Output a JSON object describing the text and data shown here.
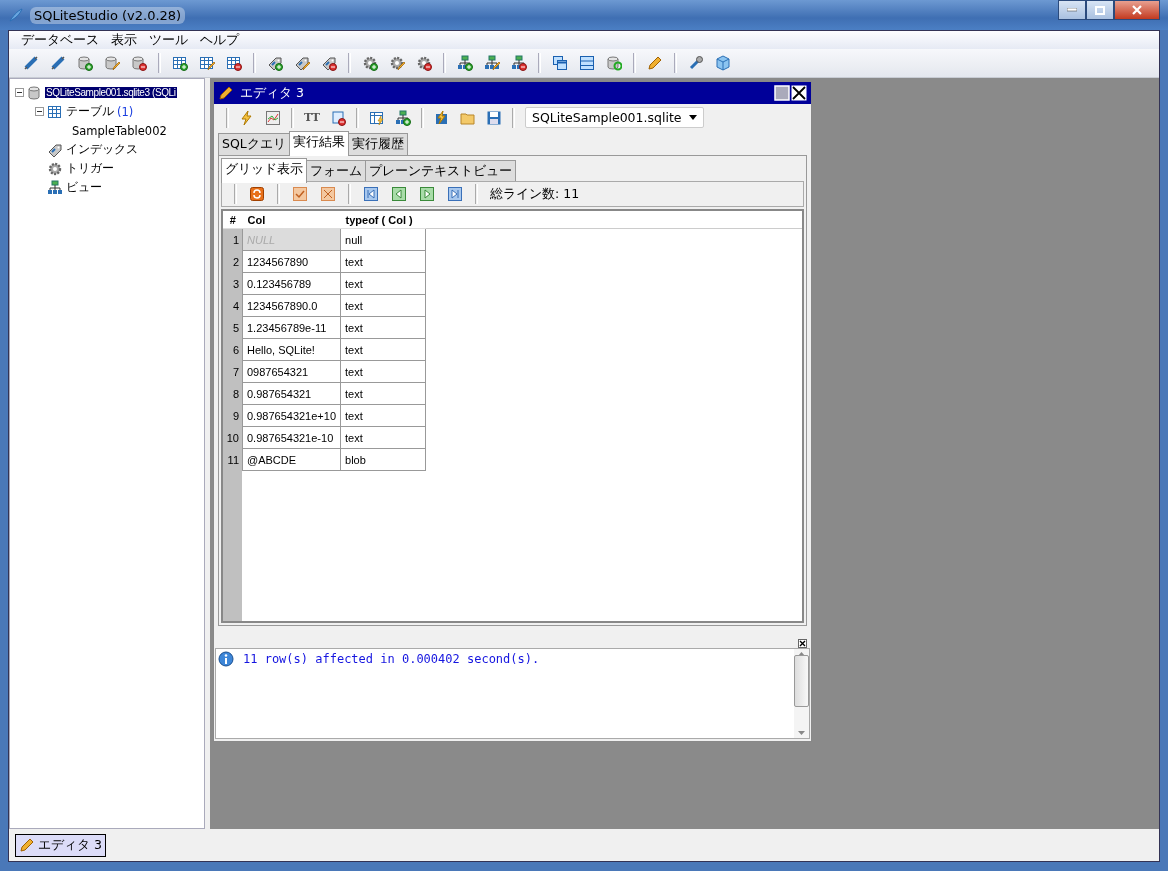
{
  "window": {
    "title": "SQLiteStudio (v2.0.28)"
  },
  "menu": [
    "データベース",
    "表示",
    "ツール",
    "ヘルプ"
  ],
  "tree": {
    "label": "SQLiteSample001.sqlite3 (SQLi",
    "kind": "database",
    "selected": true,
    "expanded": true,
    "children": [
      {
        "label": "テーブル",
        "count": "(1)",
        "kind": "table",
        "expanded": true,
        "children": [
          {
            "label": "SampleTable002"
          }
        ]
      },
      {
        "label": "インデックス",
        "kind": "index"
      },
      {
        "label": "トリガー",
        "kind": "trigger"
      },
      {
        "label": "ビュー",
        "kind": "view"
      }
    ]
  },
  "editor": {
    "title": "エディタ 3",
    "toolbar_text": "TT",
    "database": "SQLiteSample001.sqlite",
    "tabs": [
      {
        "label": "SQLクエリ",
        "selected": false
      },
      {
        "label": "実行結果",
        "selected": true
      },
      {
        "label": "実行履歴",
        "selected": false
      }
    ],
    "view_tabs": [
      {
        "label": "グリッド表示",
        "selected": true
      },
      {
        "label": "フォーム",
        "selected": false
      },
      {
        "label": "プレーンテキストビュー",
        "selected": false
      }
    ],
    "total": "総ライン数: 11",
    "columns": [
      "#",
      "Col",
      "typeof ( Col )"
    ],
    "rows": [
      {
        "num": "1",
        "col": "NULL",
        "type": "null",
        "is_null": true
      },
      {
        "num": "2",
        "col": "1234567890",
        "type": "text",
        "is_null": false
      },
      {
        "num": "3",
        "col": "0.123456789",
        "type": "text",
        "is_null": false
      },
      {
        "num": "4",
        "col": "1234567890.0",
        "type": "text",
        "is_null": false
      },
      {
        "num": "5",
        "col": "1.23456789e-11",
        "type": "text",
        "is_null": false
      },
      {
        "num": "6",
        "col": "Hello, SQLite!",
        "type": "text",
        "is_null": false
      },
      {
        "num": "7",
        "col": "0987654321",
        "type": "text",
        "is_null": false
      },
      {
        "num": "8",
        "col": "0.987654321",
        "type": "text",
        "is_null": false
      },
      {
        "num": "9",
        "col": "0.987654321e+10",
        "type": "text",
        "is_null": false
      },
      {
        "num": "10",
        "col": "0.987654321e-10",
        "type": "text",
        "is_null": false
      },
      {
        "num": "11",
        "col": "@ABCDE",
        "type": "blob",
        "is_null": false
      }
    ],
    "messages": [
      {
        "text": "11 row(s) affected in 0.000402 second(s)."
      }
    ]
  },
  "taskbar": [
    {
      "label": "エディタ 3",
      "selected": true
    }
  ]
}
